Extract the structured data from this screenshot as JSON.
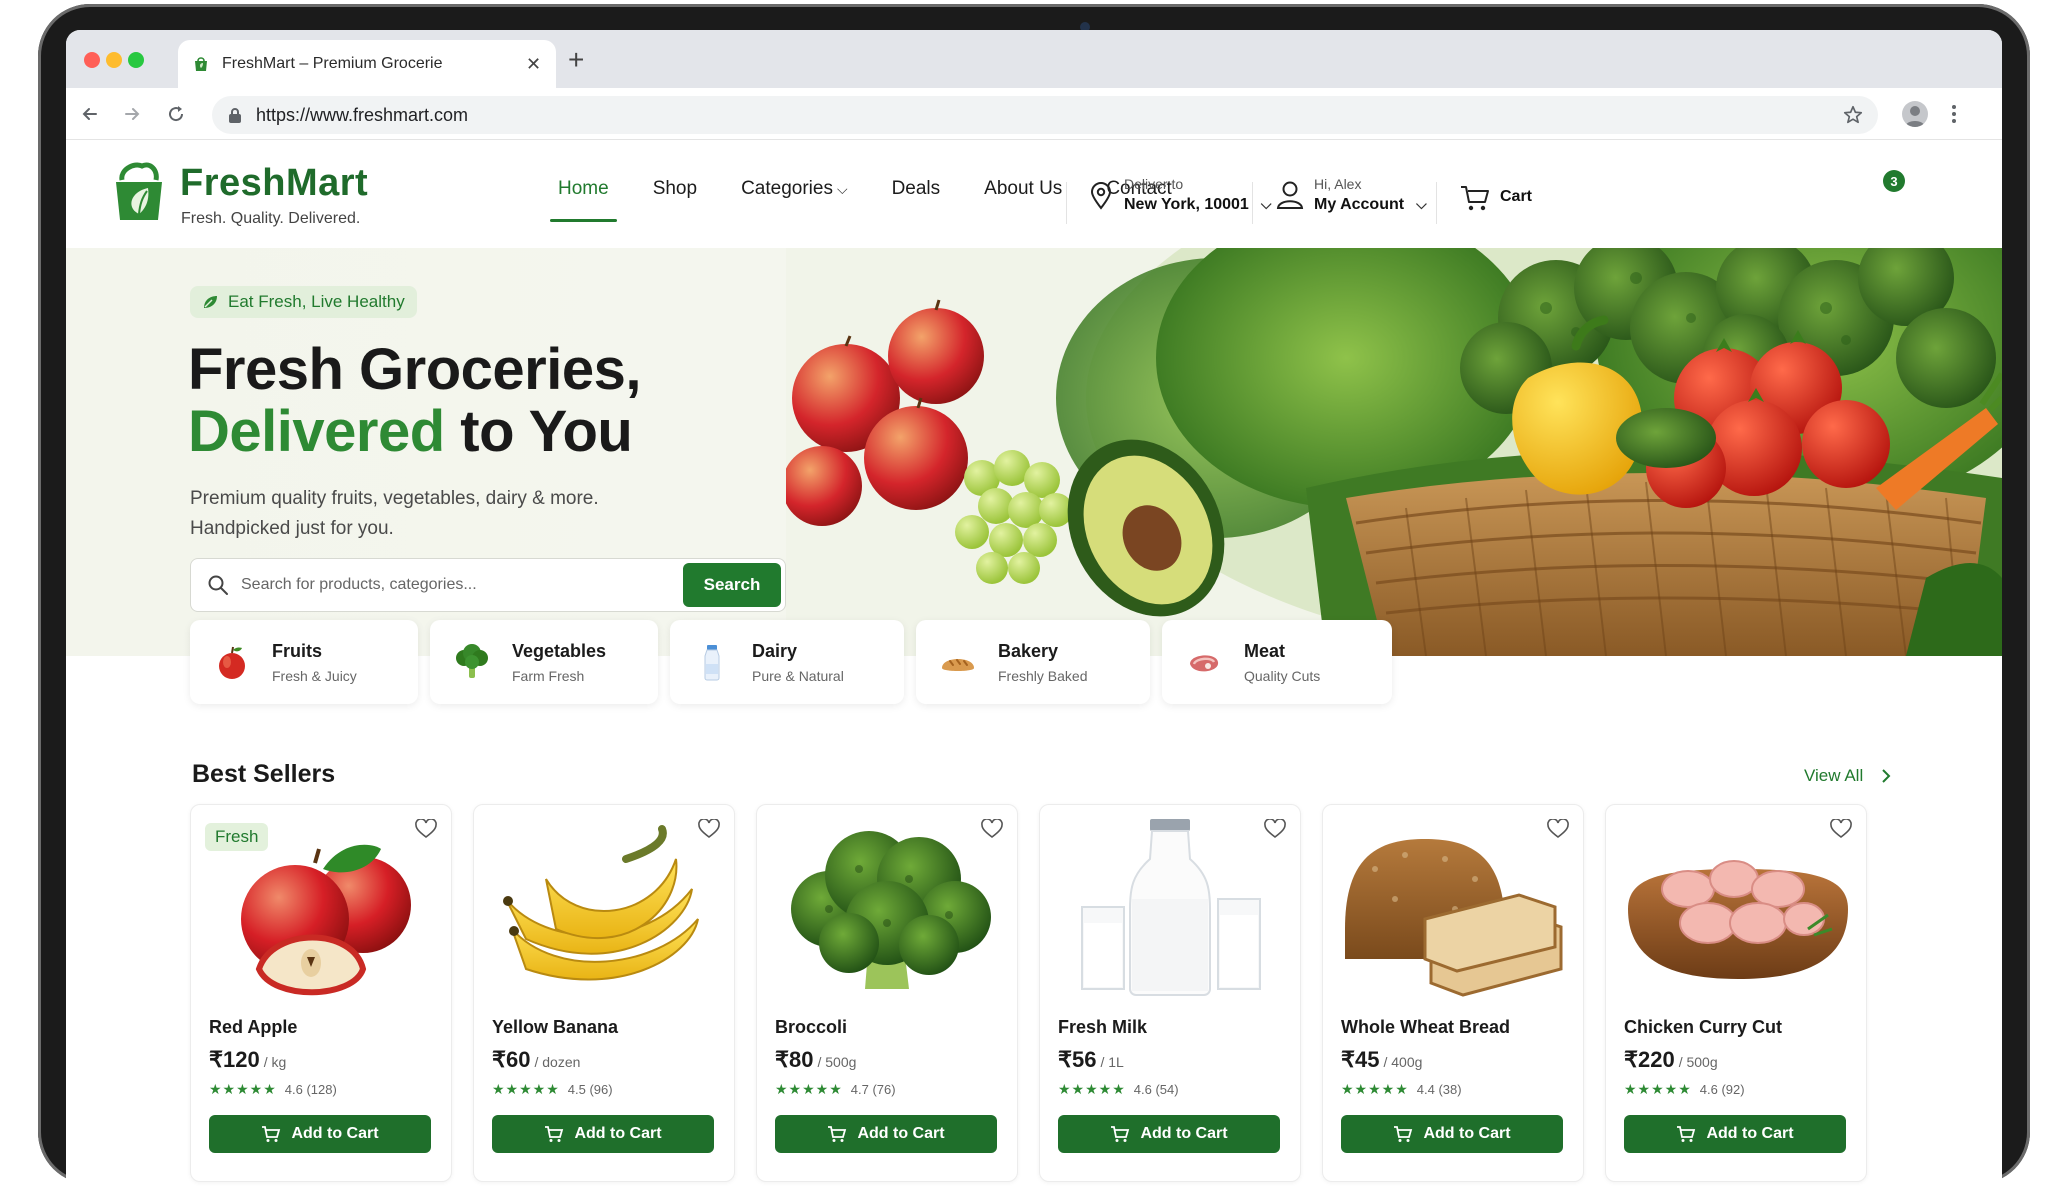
{
  "browser": {
    "tab_title": "FreshMart – Premium Grocerie",
    "url": "https://www.freshmart.com"
  },
  "header": {
    "brand": "FreshMart",
    "tagline": "Fresh. Quality. Delivered.",
    "nav": [
      {
        "label": "Home",
        "active": true
      },
      {
        "label": "Shop"
      },
      {
        "label": "Categories",
        "has_dropdown": true
      },
      {
        "label": "Deals"
      },
      {
        "label": "About Us"
      },
      {
        "label": "Contact"
      }
    ],
    "deliver_label": "Deliver to",
    "deliver_location": "New York, 10001",
    "account_greeting": "Hi, Alex",
    "account_label": "My Account",
    "cart_label": "Cart",
    "cart_count": "3"
  },
  "hero": {
    "pill": "Eat Fresh, Live Healthy",
    "title_line1": "Fresh Groceries,",
    "title_accent": "Delivered",
    "title_rest": " to You",
    "subtitle_line1": "Premium quality fruits, vegetables, dairy & more.",
    "subtitle_line2": "Handpicked just for you.",
    "search_placeholder": "Search for products, categories...",
    "search_button": "Search"
  },
  "categories": [
    {
      "name": "Fruits",
      "sub": "Fresh & Juicy",
      "icon": "apple-icon"
    },
    {
      "name": "Vegetables",
      "sub": "Farm Fresh",
      "icon": "broccoli-icon"
    },
    {
      "name": "Dairy",
      "sub": "Pure & Natural",
      "icon": "milk-bottle-icon"
    },
    {
      "name": "Bakery",
      "sub": "Freshly Baked",
      "icon": "bread-icon"
    },
    {
      "name": "Meat",
      "sub": "Quality Cuts",
      "icon": "meat-icon"
    }
  ],
  "best_sellers": {
    "title": "Best Sellers",
    "view_all": "View All",
    "add_label": "Add to Cart",
    "products": [
      {
        "name": "Red Apple",
        "price": "₹120",
        "unit": "/ kg",
        "rating": "4.6 (128)",
        "badge": "Fresh"
      },
      {
        "name": "Yellow Banana",
        "price": "₹60",
        "unit": "/ dozen",
        "rating": "4.5 (96)"
      },
      {
        "name": "Broccoli",
        "price": "₹80",
        "unit": "/ 500g",
        "rating": "4.7 (76)"
      },
      {
        "name": "Fresh Milk",
        "price": "₹56",
        "unit": "/ 1L",
        "rating": "4.6 (54)"
      },
      {
        "name": "Whole Wheat Bread",
        "price": "₹45",
        "unit": "/ 400g",
        "rating": "4.4 (38)"
      },
      {
        "name": "Chicken Curry Cut",
        "price": "₹220",
        "unit": "/ 500g",
        "rating": "4.6 (92)"
      }
    ]
  },
  "colors": {
    "brand_green": "#217a2e",
    "accent_green": "#2e8a34"
  }
}
